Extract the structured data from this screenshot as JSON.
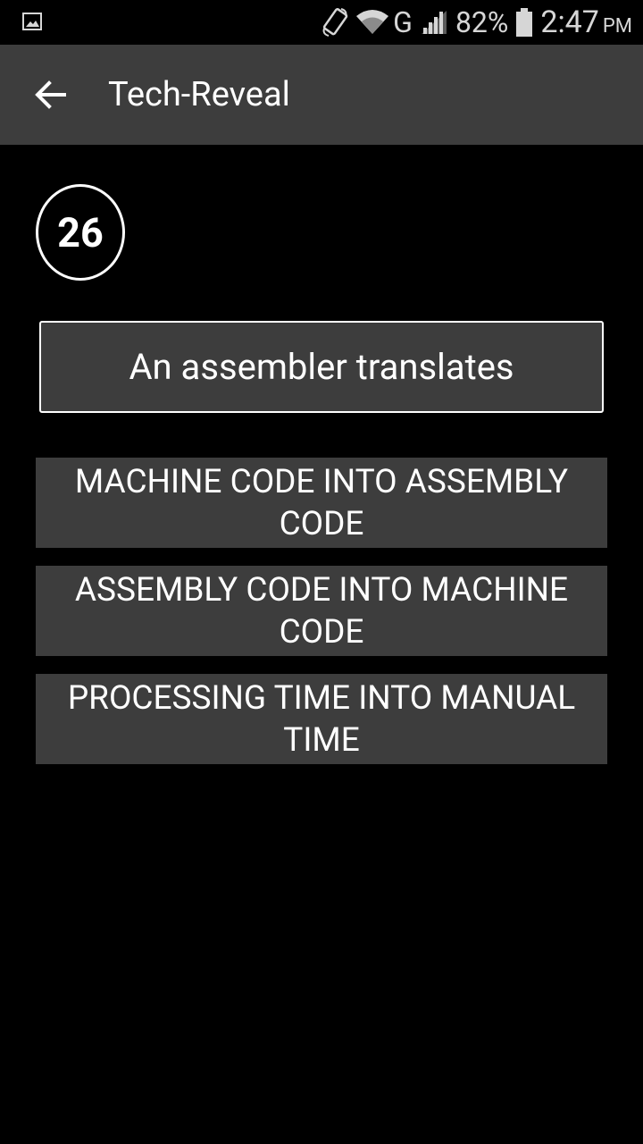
{
  "status_bar": {
    "network_type": "G",
    "battery_percent": "82%",
    "time": "2:47",
    "ampm": "PM",
    "icons": [
      "gallery-icon",
      "screen-rotate-icon",
      "wifi-icon",
      "signal-icon",
      "battery-icon"
    ]
  },
  "app_bar": {
    "title": "Tech-Reveal",
    "back_icon": "arrow-back-icon"
  },
  "quiz": {
    "question_number": "26",
    "question": "An assembler translates",
    "options": [
      "MACHINE CODE INTO ASSEMBLY CODE",
      "ASSEMBLY CODE INTO MACHINE CODE",
      "PROCESSING TIME INTO MANUAL TIME"
    ]
  },
  "colors": {
    "background": "#000000",
    "surface": "#3d3d3d",
    "text": "#ffffff",
    "status_text": "#d6d6d6"
  }
}
